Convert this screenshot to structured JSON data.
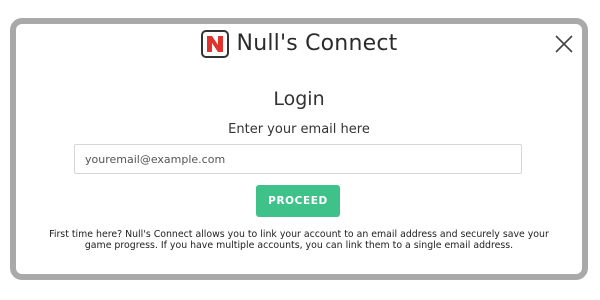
{
  "brand": {
    "name": "Null's Connect",
    "logo_icon": "null-n-logo-icon",
    "logo_color": "#e0332b"
  },
  "dialog": {
    "close_icon": "close-icon",
    "title": "Login",
    "instruction": "Enter your email here",
    "email_field": {
      "value": "",
      "placeholder": "youremail@example.com"
    },
    "proceed_label": "PROCEED",
    "proceed_color": "#3ec28a",
    "info_text": "First time here? Null's Connect allows you to link your account to an email address and securely save your game progress. If you have multiple accounts, you can link them to a single email address."
  }
}
